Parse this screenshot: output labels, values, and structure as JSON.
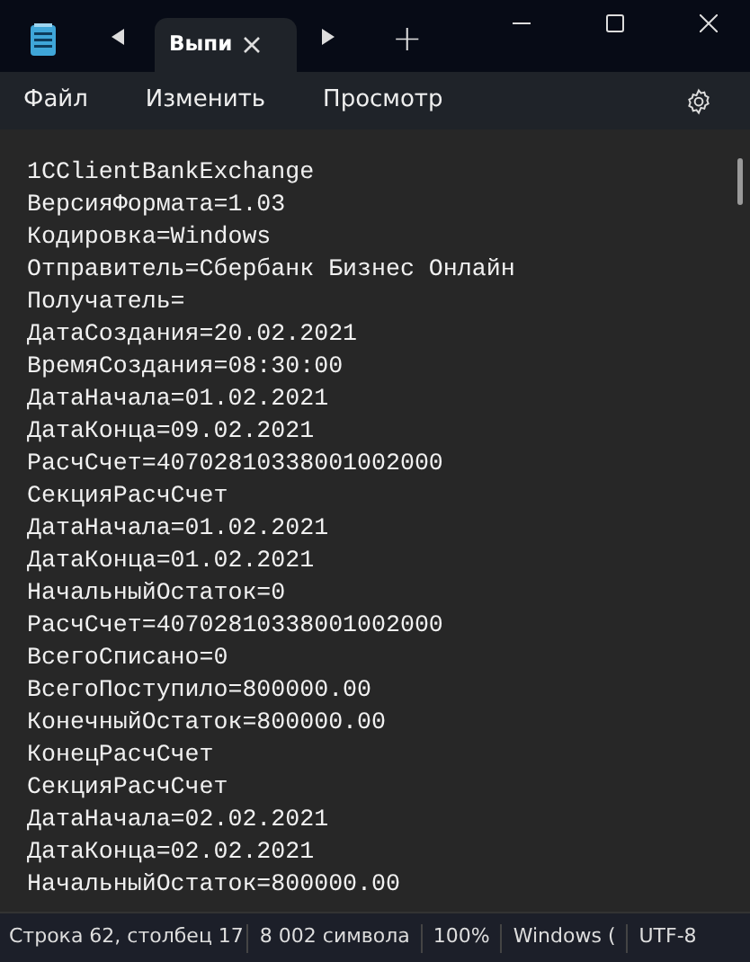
{
  "tabs": [
    {
      "title": "Выпи",
      "selected": true
    }
  ],
  "new_tab": "+",
  "menu": [
    "Файл",
    "Изменить",
    "Просмотр"
  ],
  "editor": {
    "lines": [
      "1CClientBankExchange",
      "ВерсияФормата=1.03",
      "Кодировка=Windows",
      "Отправитель=Сбербанк Бизнес Онлайн",
      "Получатель=",
      "ДатаСоздания=20.02.2021",
      "ВремяСоздания=08:30:00",
      "ДатаНачала=01.02.2021",
      "ДатаКонца=09.02.2021",
      "РасчСчет=40702810338001002000",
      "СекцияРасчСчет",
      "ДатаНачала=01.02.2021",
      "ДатаКонца=01.02.2021",
      "НачальныйОстаток=0",
      "РасчСчет=40702810338001002000",
      "ВсегоСписано=0",
      "ВсегоПоступило=800000.00",
      "КонечныйОстаток=800000.00",
      "КонецРасчСчет",
      "СекцияРасчСчет",
      "ДатаНачала=02.02.2021",
      "ДатаКонца=02.02.2021",
      "НачальныйОстаток=800000.00"
    ]
  },
  "status_bar": [
    "Строка 62, столбец 17",
    "8 002 символа",
    "100%",
    "Windows (",
    "UTF-8"
  ]
}
